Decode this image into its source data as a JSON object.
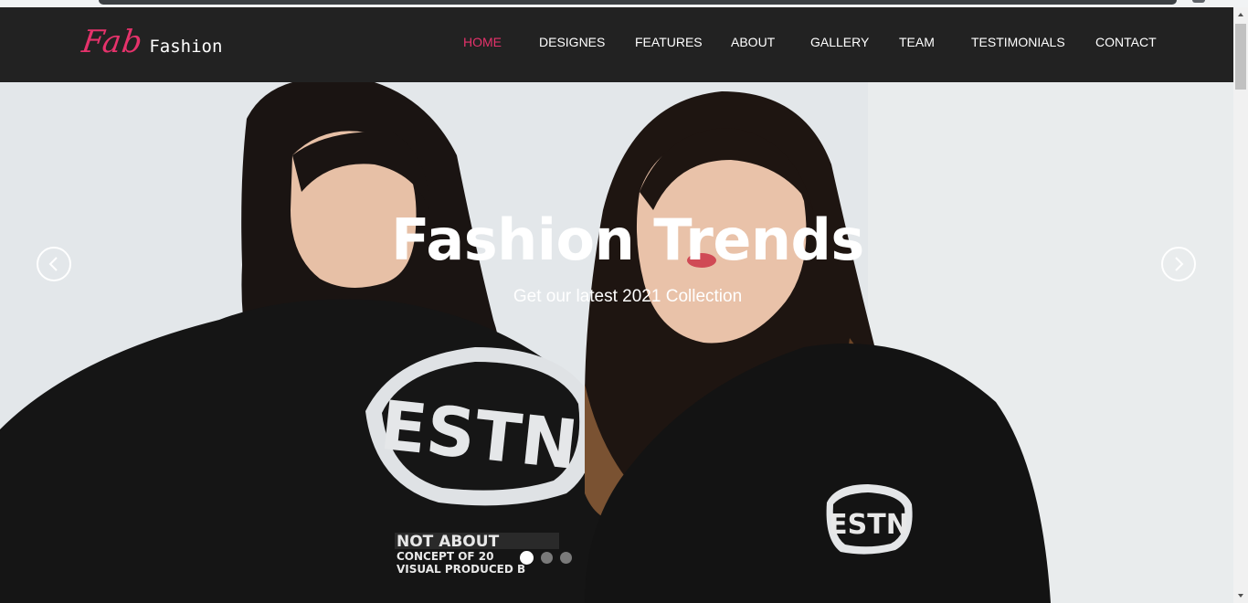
{
  "brand": {
    "script": "Fab",
    "word": "Fashion"
  },
  "nav": {
    "items": [
      {
        "label": "HOME",
        "active": true
      },
      {
        "label": "DESIGNES",
        "active": false
      },
      {
        "label": "FEATURES",
        "active": false
      },
      {
        "label": "ABOUT",
        "active": false
      },
      {
        "label": "GALLERY",
        "active": false
      },
      {
        "label": "TEAM",
        "active": false
      },
      {
        "label": "TESTIMONIALS",
        "active": false
      },
      {
        "label": "CONTACT",
        "active": false
      }
    ]
  },
  "hero": {
    "title": "Fashion Trends",
    "subtitle": "Get our latest 2021 Collection",
    "slides_total": 3,
    "active_slide": 1,
    "prev_icon": "chevron-left-icon",
    "next_icon": "chevron-right-icon",
    "logo_text": "ESTN",
    "print_text": {
      "line1": "NOT ABOUT",
      "line2": "CONCEPT OF 20",
      "line3": "VISUAL PRODUCED B"
    }
  },
  "colors": {
    "navbar_bg": "#222222",
    "accent": "#e5326b",
    "text_on_dark": "#ffffff"
  }
}
